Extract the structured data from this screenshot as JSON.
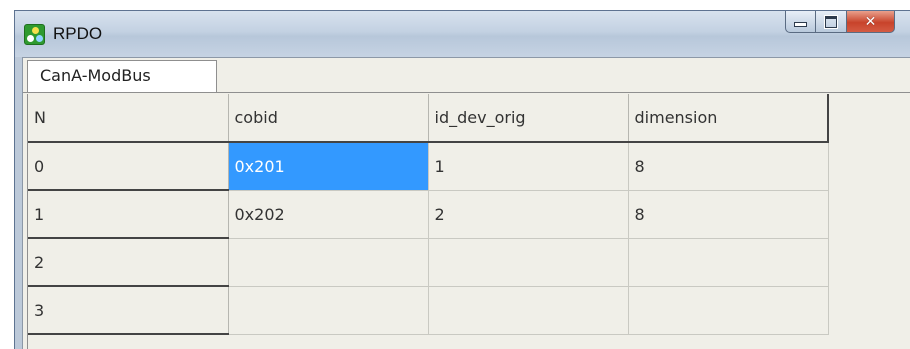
{
  "window": {
    "title": "RPDO",
    "controls": {
      "minimize": "minimize",
      "maximize": "maximize",
      "close": "x"
    }
  },
  "tabs": [
    {
      "label": "CanA-ModBus",
      "active": true
    }
  ],
  "grid": {
    "columns": [
      "N",
      "cobid",
      "id_dev_orig",
      "dimension"
    ],
    "rows": [
      {
        "n": "0",
        "cobid": "0x201",
        "id_dev_orig": "1",
        "dimension": "8",
        "selected_cell": "cobid"
      },
      {
        "n": "1",
        "cobid": "0x202",
        "id_dev_orig": "2",
        "dimension": "8"
      },
      {
        "n": "2",
        "cobid": "",
        "id_dev_orig": "",
        "dimension": ""
      },
      {
        "n": "3",
        "cobid": "",
        "id_dev_orig": "",
        "dimension": ""
      }
    ]
  },
  "colors": {
    "selection": "#3399ff",
    "grid_background": "#f0efe8",
    "close_button": "#c8432b"
  }
}
